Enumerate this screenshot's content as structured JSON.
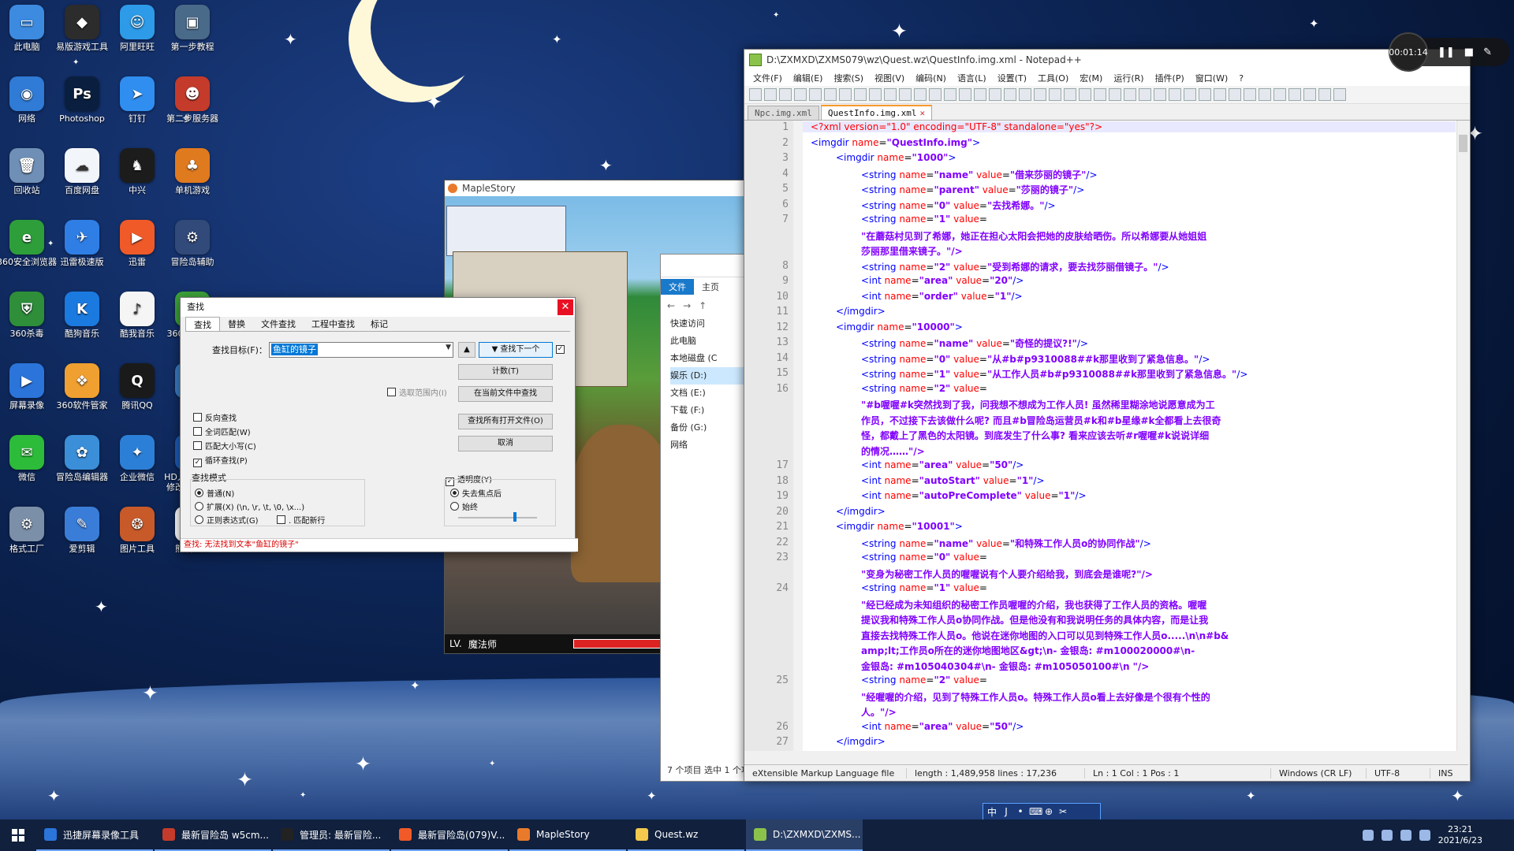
{
  "desktop_icons": [
    {
      "label": "此电脑",
      "color": "#3d8be0",
      "glyph": "▭"
    },
    {
      "label": "易版游戏工具",
      "color": "#2c2c2c",
      "glyph": "◆"
    },
    {
      "label": "阿里旺旺",
      "color": "#2d9be8",
      "glyph": "☺"
    },
    {
      "label": "第一步教程",
      "color": "#4a6a8a",
      "glyph": "▣"
    },
    {
      "label": "网络",
      "color": "#2f7bd6",
      "glyph": "◉"
    },
    {
      "label": "Photoshop",
      "color": "#0a1f3f",
      "glyph": "Ps"
    },
    {
      "label": "钉钉",
      "color": "#2f8ef0",
      "glyph": "➤"
    },
    {
      "label": "第二步服务器",
      "color": "#c43b2b",
      "glyph": "☻"
    },
    {
      "label": "回收站",
      "color": "#6f8fb6",
      "glyph": "🗑"
    },
    {
      "label": "百度网盘",
      "color": "#f2f6fb",
      "glyph": "☁"
    },
    {
      "label": "中兴",
      "color": "#1c1c1c",
      "glyph": "♞"
    },
    {
      "label": "单机游戏",
      "color": "#e07a1f",
      "glyph": "♣"
    },
    {
      "label": "360安全浏览器",
      "color": "#2e9e3b",
      "glyph": "e"
    },
    {
      "label": "迅雷极速版",
      "color": "#2f7ee6",
      "glyph": "✈"
    },
    {
      "label": "迅雷",
      "color": "#f05a28",
      "glyph": "▶"
    },
    {
      "label": "冒险岛辅助",
      "color": "#324a7a",
      "glyph": "⚙"
    },
    {
      "label": "360杀毒",
      "color": "#2e8e3a",
      "glyph": "⛨"
    },
    {
      "label": "酷狗音乐",
      "color": "#1b7ae0",
      "glyph": "K"
    },
    {
      "label": "酷我音乐",
      "color": "#f5f5f5",
      "glyph": "♪"
    },
    {
      "label": "360安全卫士",
      "color": "#3da33a",
      "glyph": "+"
    },
    {
      "label": "屏幕录像",
      "color": "#2b74da",
      "glyph": "▶"
    },
    {
      "label": "360软件管家",
      "color": "#f0a030",
      "glyph": "❖"
    },
    {
      "label": "腾讯QQ",
      "color": "#1a1a1a",
      "glyph": "Q"
    },
    {
      "label": "iSee",
      "color": "#3a7ec4",
      "glyph": "◐"
    },
    {
      "label": "微信",
      "color": "#2dbb3a",
      "glyph": "✉"
    },
    {
      "label": "冒险岛编辑器",
      "color": "#3b8fd9",
      "glyph": "✿"
    },
    {
      "label": "企业微信",
      "color": "#2c7fd6",
      "glyph": "✦"
    },
    {
      "label": "HD人物分辨率修改079.exe",
      "color": "#1d5bb5",
      "glyph": "⛃"
    },
    {
      "label": "格式工厂",
      "color": "#7b8fa8",
      "glyph": "⚙"
    },
    {
      "label": "爱剪辑",
      "color": "#3a7dd8",
      "glyph": "✎"
    },
    {
      "label": "图片工具",
      "color": "#c85a2a",
      "glyph": "❂"
    },
    {
      "label": "熊猫工具",
      "color": "#ffffff",
      "glyph": "◕"
    }
  ],
  "recorder": {
    "time": "00:01:14"
  },
  "npp": {
    "title": "D:\\ZXMXD\\ZXMS079\\wz\\Quest.wz\\QuestInfo.img.xml - Notepad++",
    "menu": [
      "文件(F)",
      "编辑(E)",
      "搜索(S)",
      "视图(V)",
      "编码(N)",
      "语言(L)",
      "设置(T)",
      "工具(O)",
      "宏(M)",
      "运行(R)",
      "插件(P)",
      "窗口(W)",
      "?"
    ],
    "tabs": [
      {
        "label": "Npc.img.xml",
        "active": false
      },
      {
        "label": "QuestInfo.img.xml",
        "active": true
      }
    ],
    "close_tab": "✕",
    "lines": [
      {
        "n": "1",
        "kind": "decl",
        "text": "<?xml version=\"1.0\" encoding=\"UTF-8\" standalone=\"yes\"?>"
      },
      {
        "n": "2",
        "kind": "open",
        "indent": 0,
        "tag": "imgdir",
        "attrs": [
          [
            "name",
            "QuestInfo.img"
          ]
        ]
      },
      {
        "n": "3",
        "kind": "open",
        "indent": 1,
        "tag": "imgdir",
        "attrs": [
          [
            "name",
            "1000"
          ]
        ]
      },
      {
        "n": "4",
        "kind": "leaf",
        "indent": 2,
        "tag": "string",
        "attrs": [
          [
            "name",
            "name"
          ],
          [
            "value",
            "借来莎丽的镜子"
          ]
        ]
      },
      {
        "n": "5",
        "kind": "leaf",
        "indent": 2,
        "tag": "string",
        "attrs": [
          [
            "name",
            "parent"
          ],
          [
            "value",
            "莎丽的镜子"
          ]
        ]
      },
      {
        "n": "6",
        "kind": "leaf",
        "indent": 2,
        "tag": "string",
        "attrs": [
          [
            "name",
            "0"
          ],
          [
            "value",
            "去找希娜。"
          ]
        ]
      },
      {
        "n": "7",
        "kind": "partial",
        "indent": 2,
        "tag": "string",
        "attrs": [
          [
            "name",
            "1"
          ]
        ]
      },
      {
        "n": "",
        "kind": "cont",
        "indent": 2,
        "text": "\"在蘑菇村见到了希娜，她正在担心太阳会把她的皮肤给晒伤。所以希娜要从她姐姐"
      },
      {
        "n": "",
        "kind": "cont",
        "indent": 2,
        "text": "莎丽那里借来镜子。\"/>"
      },
      {
        "n": "8",
        "kind": "leaf",
        "indent": 2,
        "tag": "string",
        "attrs": [
          [
            "name",
            "2"
          ],
          [
            "value",
            "受到希娜的请求，要去找莎丽借镜子。"
          ]
        ]
      },
      {
        "n": "9",
        "kind": "leaf",
        "indent": 2,
        "tag": "int",
        "attrs": [
          [
            "name",
            "area"
          ],
          [
            "value",
            "20"
          ]
        ]
      },
      {
        "n": "10",
        "kind": "leaf",
        "indent": 2,
        "tag": "int",
        "attrs": [
          [
            "name",
            "order"
          ],
          [
            "value",
            "1"
          ]
        ]
      },
      {
        "n": "11",
        "kind": "close",
        "indent": 1,
        "tag": "imgdir"
      },
      {
        "n": "12",
        "kind": "open",
        "indent": 1,
        "tag": "imgdir",
        "attrs": [
          [
            "name",
            "10000"
          ]
        ]
      },
      {
        "n": "13",
        "kind": "leaf",
        "indent": 2,
        "tag": "string",
        "attrs": [
          [
            "name",
            "name"
          ],
          [
            "value",
            "奇怪的提议?!"
          ]
        ]
      },
      {
        "n": "14",
        "kind": "leaf",
        "indent": 2,
        "tag": "string",
        "attrs": [
          [
            "name",
            "0"
          ],
          [
            "value",
            "从#b#p9310088##k那里收到了紧急信息。"
          ]
        ]
      },
      {
        "n": "15",
        "kind": "leaf",
        "indent": 2,
        "tag": "string",
        "attrs": [
          [
            "name",
            "1"
          ],
          [
            "value",
            "从工作人员#b#p9310088##k那里收到了紧急信息。"
          ]
        ]
      },
      {
        "n": "16",
        "kind": "partial",
        "indent": 2,
        "tag": "string",
        "attrs": [
          [
            "name",
            "2"
          ]
        ]
      },
      {
        "n": "",
        "kind": "cont",
        "indent": 2,
        "text": "\"#b喔喔#k突然找到了我，问我想不想成为工作人员! 虽然稀里糊涂地说愿意成为工"
      },
      {
        "n": "",
        "kind": "cont",
        "indent": 2,
        "text": "作员，不过接下去该做什么呢? 而且#b冒险岛运营员#k和#b星缘#k全都看上去很奇"
      },
      {
        "n": "",
        "kind": "cont",
        "indent": 2,
        "text": "怪，都戴上了黑色的太阳镜。到底发生了什么事? 看来应该去听#r喔喔#k说说详细"
      },
      {
        "n": "",
        "kind": "cont",
        "indent": 2,
        "text": "的情况……\"/>"
      },
      {
        "n": "17",
        "kind": "leaf",
        "indent": 2,
        "tag": "int",
        "attrs": [
          [
            "name",
            "area"
          ],
          [
            "value",
            "50"
          ]
        ]
      },
      {
        "n": "18",
        "kind": "leaf",
        "indent": 2,
        "tag": "int",
        "attrs": [
          [
            "name",
            "autoStart"
          ],
          [
            "value",
            "1"
          ]
        ]
      },
      {
        "n": "19",
        "kind": "leaf",
        "indent": 2,
        "tag": "int",
        "attrs": [
          [
            "name",
            "autoPreComplete"
          ],
          [
            "value",
            "1"
          ]
        ]
      },
      {
        "n": "20",
        "kind": "close",
        "indent": 1,
        "tag": "imgdir"
      },
      {
        "n": "21",
        "kind": "open",
        "indent": 1,
        "tag": "imgdir",
        "attrs": [
          [
            "name",
            "10001"
          ]
        ]
      },
      {
        "n": "22",
        "kind": "leaf",
        "indent": 2,
        "tag": "string",
        "attrs": [
          [
            "name",
            "name"
          ],
          [
            "value",
            "和特殊工作人员o的协同作战"
          ]
        ]
      },
      {
        "n": "23",
        "kind": "partial",
        "indent": 2,
        "tag": "string",
        "attrs": [
          [
            "name",
            "0"
          ]
        ]
      },
      {
        "n": "",
        "kind": "cont",
        "indent": 2,
        "text": "\"变身为秘密工作人员的喔喔说有个人要介绍给我，到底会是谁呢?\"/>"
      },
      {
        "n": "24",
        "kind": "partial",
        "indent": 2,
        "tag": "string",
        "attrs": [
          [
            "name",
            "1"
          ]
        ]
      },
      {
        "n": "",
        "kind": "cont",
        "indent": 2,
        "text": "\"经已经成为未知组织的秘密工作员喔喔的介绍，我也获得了工作人员的资格。喔喔"
      },
      {
        "n": "",
        "kind": "cont",
        "indent": 2,
        "text": "提议我和特殊工作人员o协同作战。但是他没有和我说明任务的具体内容，而是让我"
      },
      {
        "n": "",
        "kind": "cont",
        "indent": 2,
        "text": "直接去找特殊工作人员o。他说在迷你地图的入口可以见到特殊工作人员o.....\\n\\n#b&"
      },
      {
        "n": "",
        "kind": "cont",
        "indent": 2,
        "text": "amp;lt;工作员o所在的迷你地图地区&gt;\\n- 金银岛: #m100020000#\\n-"
      },
      {
        "n": "",
        "kind": "cont",
        "indent": 2,
        "text": "金银岛: #m105040304#\\n- 金银岛: #m105050100#\\n \"/>"
      },
      {
        "n": "25",
        "kind": "partial",
        "indent": 2,
        "tag": "string",
        "attrs": [
          [
            "name",
            "2"
          ]
        ]
      },
      {
        "n": "",
        "kind": "cont",
        "indent": 2,
        "text": "\"经喔喔的介绍，见到了特殊工作人员o。特殊工作人员o看上去好像是个很有个性的"
      },
      {
        "n": "",
        "kind": "cont",
        "indent": 2,
        "text": "人。\"/>"
      },
      {
        "n": "26",
        "kind": "leaf",
        "indent": 2,
        "tag": "int",
        "attrs": [
          [
            "name",
            "area"
          ],
          [
            "value",
            "50"
          ]
        ]
      },
      {
        "n": "27",
        "kind": "close",
        "indent": 1,
        "tag": "imgdir"
      }
    ],
    "status": {
      "lang": "eXtensible Markup Language file",
      "length": "length : 1,489,958   lines : 17,236",
      "pos": "Ln : 1    Col : 1    Pos : 1",
      "eol": "Windows (CR LF)",
      "enc": "UTF-8",
      "ins": "INS"
    }
  },
  "maple": {
    "title": "MapleStory",
    "hud_lv": "LV.",
    "hud_name": "魔法师",
    "hp": "HP",
    "mp": "MP"
  },
  "explorer": {
    "tabs": [
      "文件",
      "主页"
    ],
    "tree": [
      "快速访问",
      "此电脑",
      "本地磁盘 (C",
      "娱乐 (D:)",
      "文档 (E:)",
      "下载 (F:)",
      "备份 (G:)",
      "网络"
    ],
    "footer": "7 个项目    选中 1 个项目 1.42 MB"
  },
  "find": {
    "title": "查找",
    "close": "✕",
    "tabs": [
      "查找",
      "替换",
      "文件查找",
      "工程中查找",
      "标记"
    ],
    "find_label": "查找目标(F)：",
    "find_value": "鱼缸的镜子",
    "btn_prev": "▲",
    "btn_next": "▼ 查找下一个",
    "btn_count": "计数(T)",
    "btn_find_all_current": "在当前文件中查找",
    "btn_find_all_open": "查找所有打开文件(O)",
    "btn_close": "取消",
    "in_selection": "选取范围内(I)",
    "opt_backward": "反向查找",
    "opt_whole": "全词匹配(W)",
    "opt_case": "匹配大小写(C)",
    "opt_wrap": "循环查找(P)",
    "mode_title": "查找模式",
    "mode_normal": "普通(N)",
    "mode_ext": "扩展(X) (\\n, \\r, \\t, \\0, \\x...)",
    "mode_regex": "正则表达式(G)",
    "mode_dot": ". 匹配新行",
    "trans_title": "透明度(Y)",
    "trans_focus": "失去焦点后",
    "trans_always": "始终",
    "status": "查找: 无法找到文本\"鱼缸的镜子\""
  },
  "ime": [
    "中",
    "J",
    "•",
    "⌨",
    "⊕",
    "✂"
  ],
  "taskbar": {
    "items": [
      {
        "label": "迅捷屏幕录像工具",
        "color": "#2b74da",
        "active": false
      },
      {
        "label": "最新冒险岛 w5cm...",
        "color": "#c43b2b",
        "active": false
      },
      {
        "label": "管理员: 最新冒险...",
        "color": "#222",
        "active": false
      },
      {
        "label": "最新冒险岛(079)V...",
        "color": "#f05a28",
        "active": false
      },
      {
        "label": "MapleStory",
        "color": "#e97a2b",
        "active": false
      },
      {
        "label": "Quest.wz",
        "color": "#f2c94c",
        "active": false
      },
      {
        "label": "D:\\ZXMXD\\ZXMS...",
        "color": "#8bc34a",
        "active": true
      }
    ],
    "time": "23:21",
    "date": "2021/6/23"
  }
}
